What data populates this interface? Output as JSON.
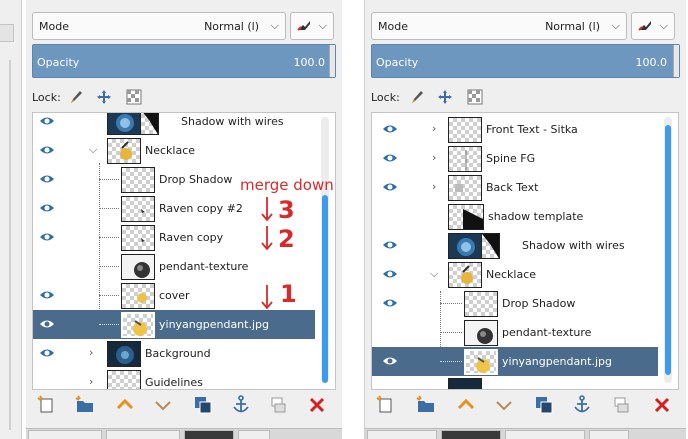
{
  "left_panel": {
    "mode": {
      "label": "Mode",
      "value": "Normal (l)"
    },
    "opacity": {
      "label": "Opacity",
      "value": "100.0"
    },
    "lock_label": "Lock:",
    "layers": [
      {
        "name": "Shadow with wires",
        "visible": true,
        "expander": "",
        "selected": false
      },
      {
        "name": "Necklace",
        "visible": true,
        "expander": "down",
        "selected": false
      },
      {
        "name": "Drop Shadow",
        "visible": true,
        "expander": "",
        "selected": false
      },
      {
        "name": "Raven copy #2",
        "visible": true,
        "expander": "",
        "selected": false
      },
      {
        "name": "Raven copy",
        "visible": true,
        "expander": "",
        "selected": false
      },
      {
        "name": "pendant-texture",
        "visible": false,
        "expander": "",
        "selected": false
      },
      {
        "name": "cover",
        "visible": true,
        "expander": "",
        "selected": false
      },
      {
        "name": "yinyangpendant.jpg",
        "visible": true,
        "expander": "",
        "selected": true
      },
      {
        "name": "Background",
        "visible": true,
        "expander": "right",
        "selected": false
      },
      {
        "name": "Guidelines",
        "visible": false,
        "expander": "right",
        "selected": false
      }
    ]
  },
  "right_panel": {
    "mode": {
      "label": "Mode",
      "value": "Normal (l)"
    },
    "opacity": {
      "label": "Opacity",
      "value": "100.0"
    },
    "lock_label": "Lock:",
    "layers": [
      {
        "name": "Front Text - Sitka",
        "visible": true,
        "expander": "right",
        "selected": false
      },
      {
        "name": "Spine FG",
        "visible": true,
        "expander": "right",
        "selected": false
      },
      {
        "name": "Back Text",
        "visible": true,
        "expander": "right",
        "selected": false
      },
      {
        "name": "shadow template",
        "visible": false,
        "expander": "",
        "selected": false
      },
      {
        "name": "Shadow with wires",
        "visible": true,
        "expander": "",
        "selected": false
      },
      {
        "name": "Necklace",
        "visible": true,
        "expander": "down",
        "selected": false
      },
      {
        "name": "Drop Shadow",
        "visible": true,
        "expander": "",
        "selected": false
      },
      {
        "name": "pendant-texture",
        "visible": false,
        "expander": "",
        "selected": false
      },
      {
        "name": "yinyangpendant.jpg",
        "visible": true,
        "expander": "",
        "selected": true
      }
    ]
  },
  "toolbar_icons": [
    "new-layer-icon",
    "new-group-icon",
    "raise-layer-icon",
    "lower-layer-icon",
    "duplicate-layer-icon",
    "anchor-icon",
    "merge-down-icon",
    "delete-layer-icon"
  ],
  "annotations": {
    "title": "merge down",
    "step_3": "3",
    "step_2": "2",
    "step_1": "1"
  },
  "colors": {
    "selection": "#4a6b8c",
    "opacity_bar": "#6d97bf",
    "scrollbar": "#3d9be9",
    "annotation": "#d92a2a",
    "raise_arrow": "#e8901f",
    "delete": "#d61f1f"
  }
}
